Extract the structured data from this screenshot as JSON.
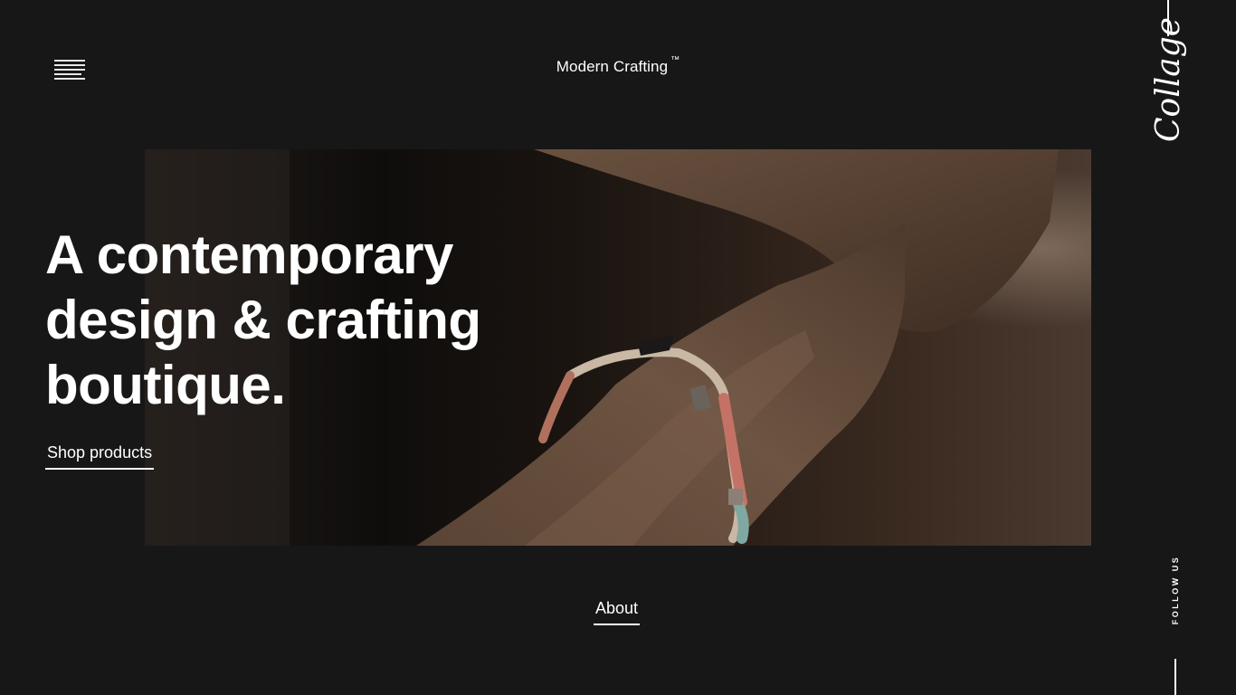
{
  "header": {
    "brand_name": "Modern Crafting",
    "brand_mark": "™",
    "menu_icon": "hamburger-menu-icon"
  },
  "logo": {
    "text": "Collage"
  },
  "hero": {
    "image_alt": "Wrist wearing a braided rope bracelet",
    "headline_lines": [
      "A contemporary",
      "design & crafting",
      "boutique."
    ],
    "cta_label": "Shop products"
  },
  "footer_nav": {
    "about_label": "About"
  },
  "social": {
    "follow_label": "FOLLOW US"
  },
  "colors": {
    "background": "#171717",
    "text": "#ffffff",
    "accent_line": "#ffffff"
  }
}
